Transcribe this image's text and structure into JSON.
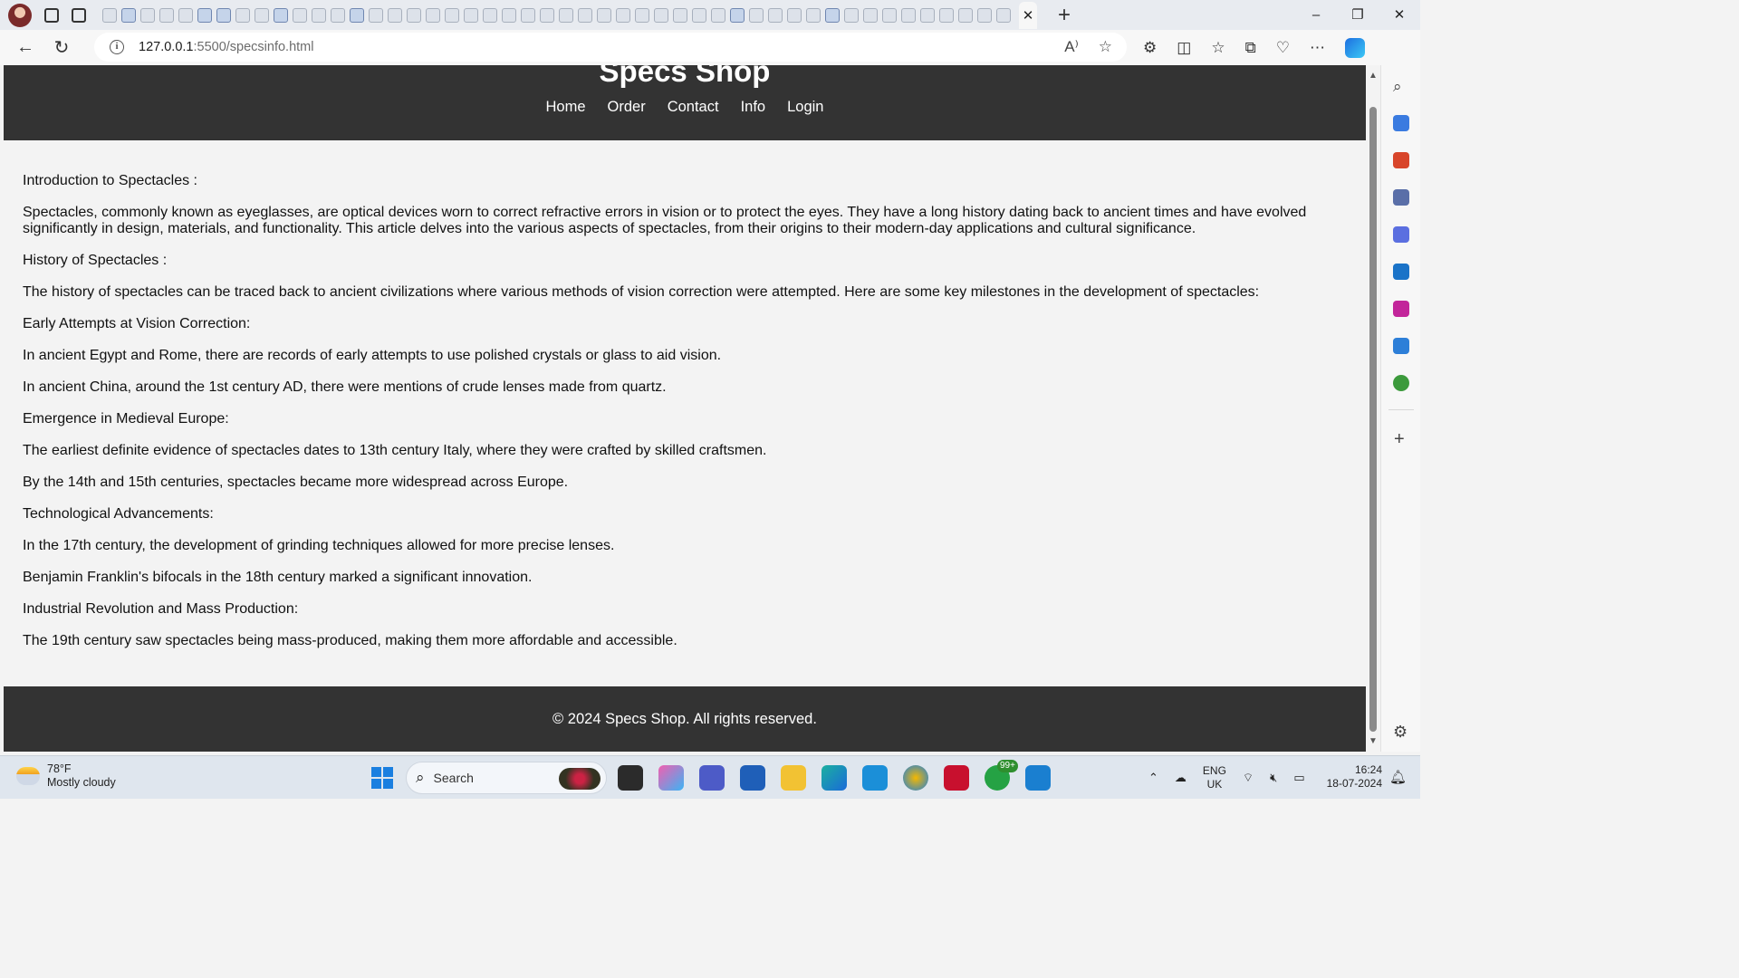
{
  "browser": {
    "url_host": "127.0.0.1",
    "url_path": ":5500/specsinfo.html",
    "tab_close": "✕",
    "new_tab": "+",
    "window_controls": [
      "–",
      "❐",
      "✕"
    ]
  },
  "site": {
    "title": "Specs Shop",
    "nav": [
      "Home",
      "Order",
      "Contact",
      "Info",
      "Login"
    ],
    "paragraphs": [
      "Introduction to Spectacles :",
      "Spectacles, commonly known as eyeglasses, are optical devices worn to correct refractive errors in vision or to protect the eyes. They have a long history dating back to ancient times and have evolved significantly in design, materials, and functionality. This article delves into the various aspects of spectacles, from their origins to their modern-day applications and cultural significance.",
      "History of Spectacles :",
      "The history of spectacles can be traced back to ancient civilizations where various methods of vision correction were attempted. Here are some key milestones in the development of spectacles:",
      "Early Attempts at Vision Correction:",
      "In ancient Egypt and Rome, there are records of early attempts to use polished crystals or glass to aid vision.",
      "In ancient China, around the 1st century AD, there were mentions of crude lenses made from quartz.",
      "Emergence in Medieval Europe:",
      "The earliest definite evidence of spectacles dates to 13th century Italy, where they were crafted by skilled craftsmen.",
      "By the 14th and 15th centuries, spectacles became more widespread across Europe.",
      "Technological Advancements:",
      "In the 17th century, the development of grinding techniques allowed for more precise lenses.",
      "Benjamin Franklin's bifocals in the 18th century marked a significant innovation.",
      "Industrial Revolution and Mass Production:",
      "The 19th century saw spectacles being mass-produced, making them more affordable and accessible."
    ],
    "footer": "© 2024 Specs Shop. All rights reserved."
  },
  "taskbar": {
    "weather_temp": "78°F",
    "weather_desc": "Mostly cloudy",
    "search_label": "Search",
    "whatsapp_badge": "99+",
    "lang_top": "ENG",
    "lang_bottom": "UK",
    "time": "16:24",
    "date": "18-07-2024"
  },
  "colors": {
    "header_bg": "#333333",
    "page_bg": "#f3f3f3",
    "taskbar_bg": "#dfe6ee"
  }
}
